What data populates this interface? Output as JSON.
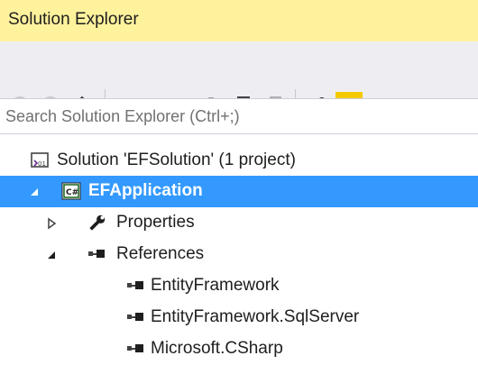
{
  "panel": {
    "title": "Solution Explorer"
  },
  "toolbar": {
    "buttons": [
      {
        "name": "back",
        "icon": "back-arrow-icon"
      },
      {
        "name": "forward",
        "icon": "forward-arrow-icon"
      },
      {
        "name": "home",
        "icon": "home-icon"
      },
      {
        "name": "pending-changes-filter",
        "icon": "clock-icon"
      },
      {
        "name": "sync-with-active-document",
        "icon": "sync-icon"
      },
      {
        "name": "refresh",
        "icon": "refresh-icon"
      },
      {
        "name": "collapse-all",
        "icon": "collapse-all-icon"
      },
      {
        "name": "show-all-files",
        "icon": "show-all-files-icon"
      },
      {
        "name": "properties",
        "icon": "wrench-icon"
      },
      {
        "name": "preview-selected-items",
        "icon": "preview-icon"
      }
    ]
  },
  "search": {
    "placeholder": "Search Solution Explorer (Ctrl+;)"
  },
  "tree": {
    "items": [
      {
        "label": "Solution 'EFSolution' (1 project)",
        "icon": "solution-icon",
        "level": 0,
        "expander": "none"
      },
      {
        "label": "EFApplication",
        "icon": "csharp-project-icon",
        "level": 0,
        "expander": "expanded",
        "selected": true
      },
      {
        "label": "Properties",
        "icon": "wrench-icon",
        "level": 1,
        "expander": "collapsed"
      },
      {
        "label": "References",
        "icon": "references-icon",
        "level": 1,
        "expander": "expanded"
      },
      {
        "label": "EntityFramework",
        "icon": "reference-icon",
        "level": 2,
        "expander": "none"
      },
      {
        "label": "EntityFramework.SqlServer",
        "icon": "reference-icon",
        "level": 2,
        "expander": "none"
      },
      {
        "label": "Microsoft.CSharp",
        "icon": "reference-icon",
        "level": 2,
        "expander": "none"
      }
    ]
  },
  "colors": {
    "title_bar": "#fff29d",
    "toolbar_bg": "#eeeef2",
    "selection": "#3399ff",
    "icon_dark": "#424242",
    "icon_disabled": "#a0a0a0",
    "active_toggle": "#f5c900"
  }
}
